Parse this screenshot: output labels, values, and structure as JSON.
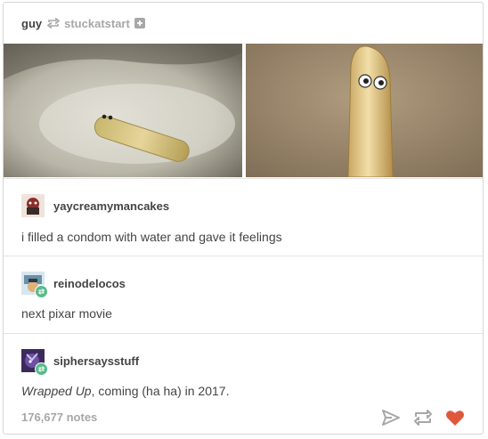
{
  "post": {
    "author": "guy",
    "source": "stuckatstart",
    "icons": {
      "reblog": "reblog-icon",
      "follow": "plus-square-icon",
      "share": "paper-plane-icon",
      "reblog_action": "reblog-icon",
      "like": "heart-icon"
    },
    "colors": {
      "like": "#e0583c",
      "reblog_badge": "#56bc8a",
      "muted": "#a7a7a7"
    }
  },
  "notes": [
    {
      "username": "yaycreamymancakes",
      "text": "i filled a condom with water and gave it feelings"
    },
    {
      "username": "reinodelocos",
      "text": "next pixar movie"
    },
    {
      "username": "siphersaysstuff",
      "text_italic": "Wrapped Up",
      "text_rest": ", coming (ha ha) in 2017."
    }
  ],
  "footer": {
    "notes_count": "176,677 notes"
  }
}
